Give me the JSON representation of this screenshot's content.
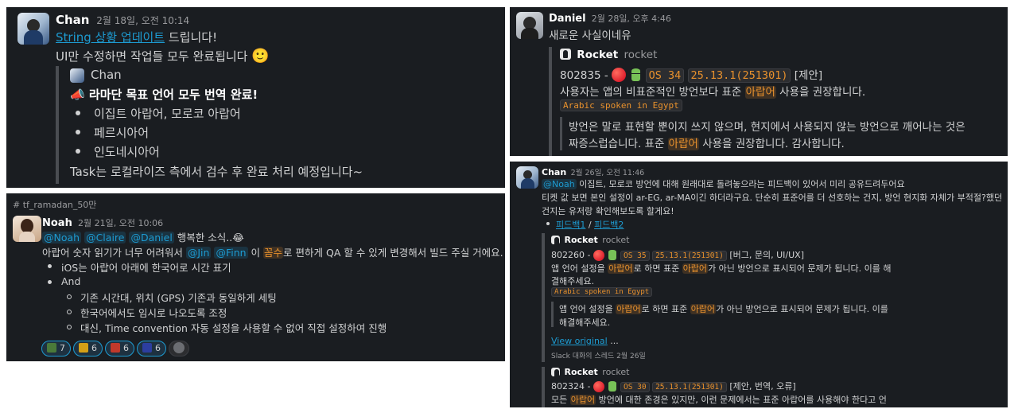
{
  "panel1": {
    "author": "Chan",
    "time": "2월 18일, 오전 10:14",
    "line1_link": "String 상황 업데이트",
    "line1_rest": " 드립니다!",
    "line2": "UI만 수정하면 작업들 모두 완료됩니다",
    "line2_emoji": "🙂",
    "quote_author": "Chan",
    "quote_emoji": "📣",
    "quote_title": "라마단 목표 언어 모두 번역 완료!",
    "bullets": [
      "이집트 아랍어, 모로코 아랍어",
      "페르시아어",
      "인도네시아어"
    ],
    "footer": "Task는 로컬라이즈 측에서 검수 후 완료 처리 예정입니다~"
  },
  "panel2": {
    "channel": "# tf_ramadan_50만",
    "author": "Noah",
    "time": "2월 21일, 오전 10:06",
    "mentions1": [
      "@Noah",
      "@Claire",
      "@Daniel"
    ],
    "line1_rest": " 행복한 소식..",
    "line1_emoji": "😂",
    "line2_a": "아랍어 숫자 읽기가 너무 어려워서 ",
    "mentions2": [
      "@Jin",
      "@Finn"
    ],
    "line2_b": " 이 ",
    "line2_hl": "꼼수",
    "line2_c": "로 편하게 QA 할 수 있게 변경해서 빌드 주실 거에요.",
    "bullet1": "iOS는 아랍어 아래에 한국어로 시간 표기",
    "bullet2": "And",
    "sub_bullets": [
      "기존 시간대, 위치 (GPS)  기존과 동일하게 세팅",
      "한국어에서도 임시로 나오도록 조정",
      "대신, Time convention 자동 설정을 사용할 수 없어 직접 설정하여 진행"
    ],
    "reactions": [
      {
        "count": "7",
        "color": "#4a7a3a"
      },
      {
        "count": "6",
        "color": "#d4a017"
      },
      {
        "count": "6",
        "color": "#c0392b"
      },
      {
        "count": "6",
        "color": "#2c3e9f"
      }
    ]
  },
  "panel3": {
    "author": "Daniel",
    "time": "2월 28일, 오후 4:46",
    "message": "새로운 사실이네유",
    "app_name": "Rocket",
    "app_sub": "rocket",
    "ticket": "802835 - ",
    "os_tag": "OS 34",
    "ver_tag": "25.13.1(251301)",
    "tag_text": " [제안]",
    "line_a": "사용자는 앱의 비표준적인 방언보다 표준 ",
    "line_hl": "아랍어",
    "line_b": " 사용을 권장합니다.",
    "code": "Arabic spoken in Egypt",
    "quote1": "방언은 말로 표현할 뿐이지 쓰지 않으며, 현지에서 사용되지 않는 방언으로 깨어나는 것은",
    "quote2_a": "짜증스럽습니다. 표준 ",
    "quote2_hl": "아랍어",
    "quote2_b": " 사용을 권장합니다. 감사합니다."
  },
  "panel4": {
    "author": "Chan",
    "time": "2월 26일, 오전 11:46",
    "mention": "@Noah",
    "line1_rest": " 이집트, 모로코 방언에 대해 원래대로 돌려놓으라는 피드백이 있어서 미리 공유드려두어요",
    "line2": "티켓 값 보면 본인 설정이 ar-EG, ar-MA이긴 하더라구요. 단순히 표준어를 더 선호하는 건지, 방언 현지화 자체가 부적절?했던",
    "line3": "건지는 유저랑 확인해보도록 할게요!",
    "fb1": "피드백1",
    "fb_sep": " / ",
    "fb2": "피드백2",
    "card1": {
      "app_name": "Rocket",
      "app_sub": "rocket",
      "ticket": "802260 - ",
      "os_tag": "OS 35",
      "ver_tag": "25.13.1(251301)",
      "tag_text": " [버그, 문의, UI/UX]",
      "l1_a": "앱 언어 설정을 ",
      "l1_hl1": "아랍어",
      "l1_b": "로 하면 표준 ",
      "l1_hl2": "아랍어",
      "l1_c": "가 아닌 방언으로 표시되어 문제가 됩니다. 이를 해",
      "l2": "결해주세요.",
      "code": "Arabic spoken in Egypt",
      "q1_a": "앱 언어 설정을 ",
      "q1_hl1": "아랍어",
      "q1_b": "로 하면 표준 ",
      "q1_hl2": "아랍어",
      "q1_c": "가 아닌 방언으로 표시되어 문제가 됩니다. 이를",
      "q2": "해결해주세요.",
      "view": "View original",
      "view_dots": " ...",
      "meta": "Slack 대화의 스레드  2월 26일"
    },
    "card2": {
      "app_name": "Rocket",
      "app_sub": "rocket",
      "ticket": "802324 - ",
      "os_tag": "OS 30",
      "ver_tag": "25.13.1(251301)",
      "tag_text": " [제안, 번역, 오류]",
      "l1_a": "모든 ",
      "l1_hl": "아랍어",
      "l1_b": " 방언에 대한 존경은 있지만, 이런 문제에서는 표준 아랍어를 사용해야 한다고 언"
    }
  }
}
